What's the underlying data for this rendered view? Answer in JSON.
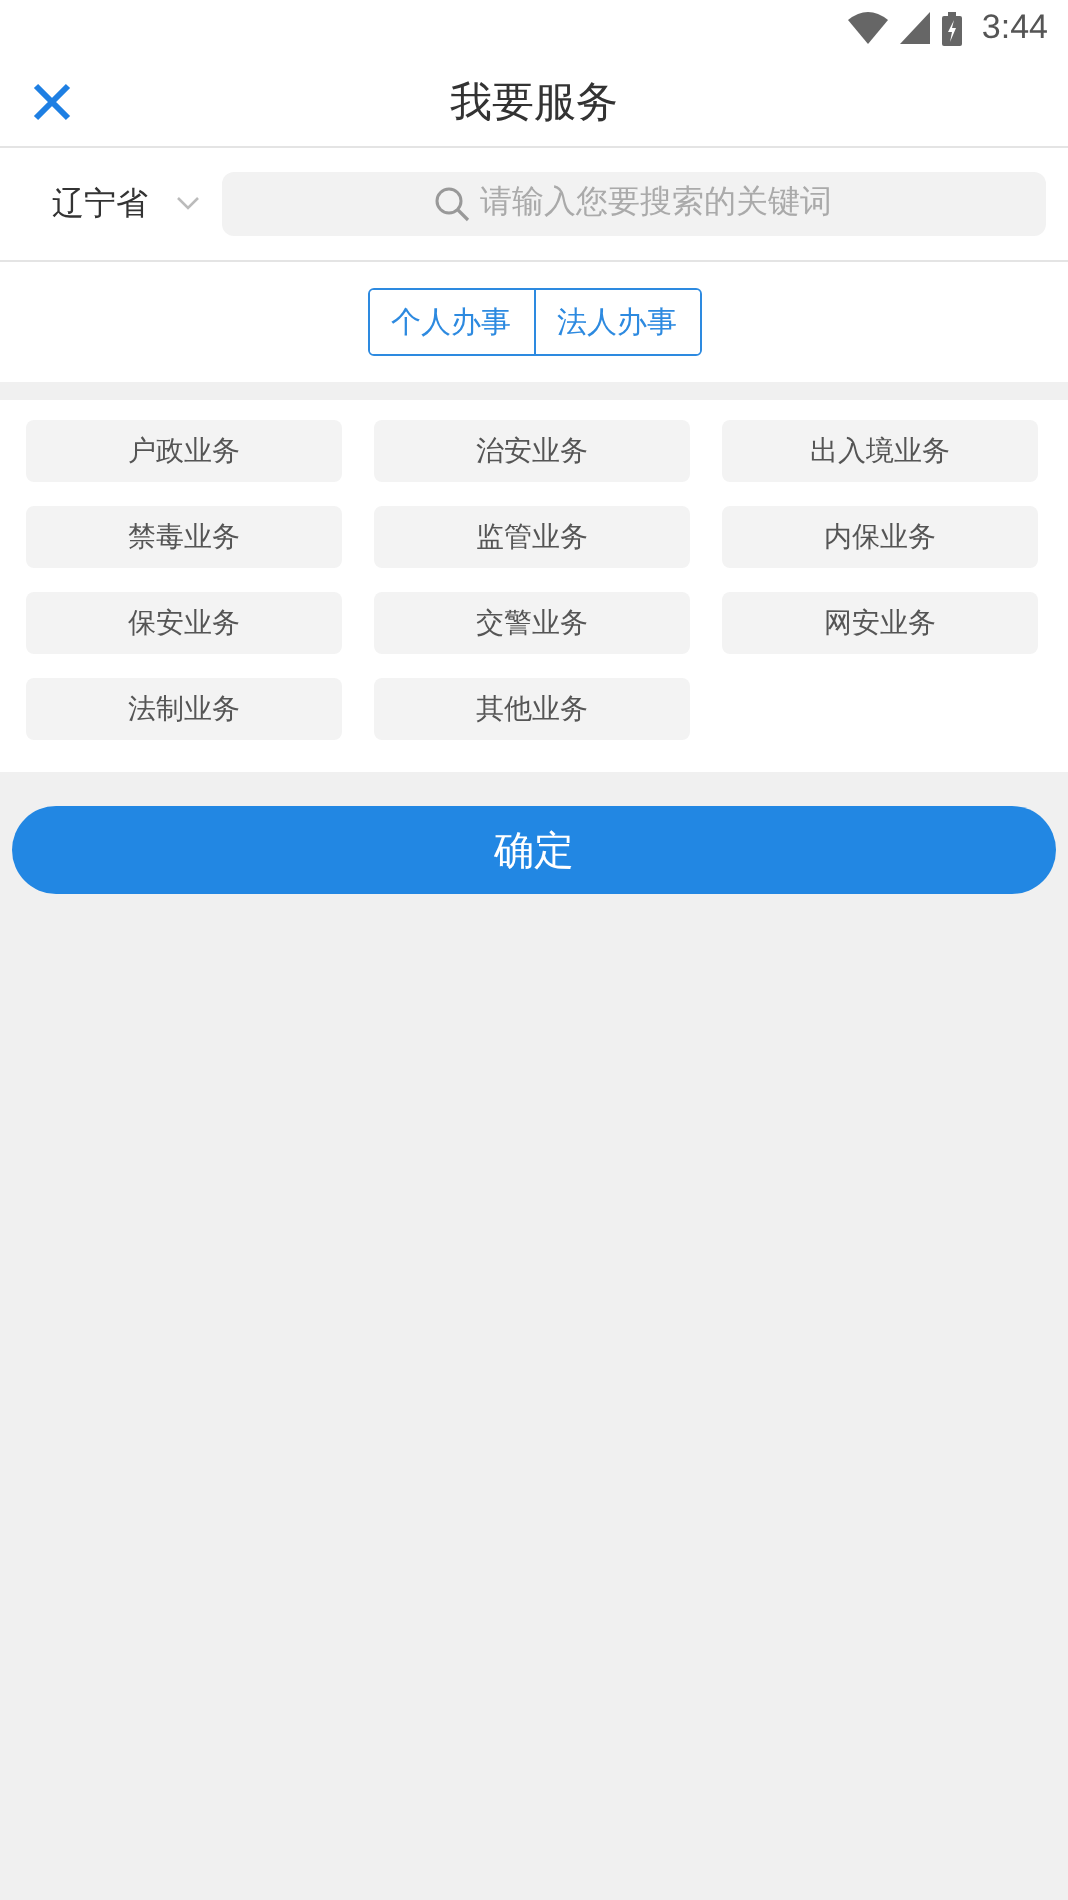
{
  "status_bar": {
    "time": "3:44"
  },
  "header": {
    "title": "我要服务"
  },
  "filter": {
    "region": "辽宁省",
    "search": {
      "placeholder": "请输入您要搜索的关键词"
    }
  },
  "tabs": [
    {
      "label": "个人办事"
    },
    {
      "label": "法人办事"
    }
  ],
  "categories": [
    "户政业务",
    "治安业务",
    "出入境业务",
    "禁毒业务",
    "监管业务",
    "内保业务",
    "保安业务",
    "交警业务",
    "网安业务",
    "法制业务",
    "其他业务"
  ],
  "confirm_button": "确定"
}
